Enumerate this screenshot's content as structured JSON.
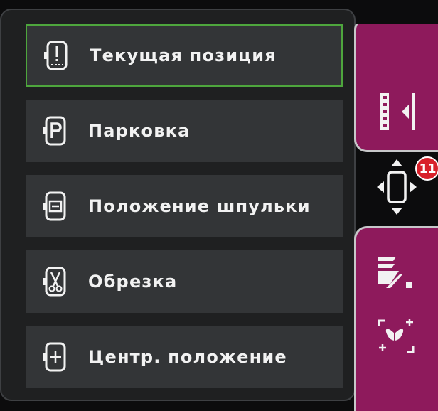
{
  "menu": {
    "items": [
      {
        "label": "Текущая позиция",
        "icon": "needle-position-icon",
        "selected": true
      },
      {
        "label": "Парковка",
        "icon": "park-icon",
        "selected": false
      },
      {
        "label": "Положение шпульки",
        "icon": "bobbin-position-icon",
        "selected": false
      },
      {
        "label": "Обрезка",
        "icon": "scissors-icon",
        "selected": false
      },
      {
        "label": "Центр. положение",
        "icon": "center-position-icon",
        "selected": false
      }
    ]
  },
  "toolbar": {
    "top_icon": "hoop-position-icon",
    "move_icon": "move-arrows-icon",
    "badge_number": "11",
    "bottom_icons": [
      "stitch-density-icon",
      "embroidery-design-icon"
    ]
  },
  "colors": {
    "panel": "#1f2021",
    "item": "#333537",
    "selected_border": "#4ea63d",
    "toolbar": "#8e1a5c",
    "badge": "#d8202a"
  }
}
